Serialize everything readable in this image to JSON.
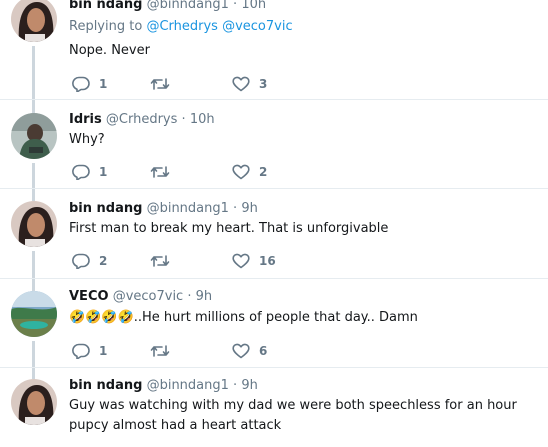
{
  "tweets": [
    {
      "name": "bin ndang",
      "handle": "@binndang1",
      "time": "10h",
      "replying_label": "Replying to",
      "replying_to": [
        "@Crhedrys",
        "@veco7vic"
      ],
      "text": "Nope. Never",
      "replies": "1",
      "retweets": "",
      "likes": "3"
    },
    {
      "name": "Idris",
      "handle": "@Crhedrys",
      "time": "10h",
      "text": "Why?",
      "replies": "1",
      "retweets": "",
      "likes": "2"
    },
    {
      "name": "bin ndang",
      "handle": "@binndang1",
      "time": "9h",
      "text": "First man to break my heart. That is unforgivable",
      "replies": "2",
      "retweets": "",
      "likes": "16"
    },
    {
      "name": "VECO",
      "handle": "@veco7vic",
      "time": "9h",
      "text_emoji": "🤣🤣🤣🤣",
      "text": "..He hurt millions of people that day.. Damn",
      "replies": "1",
      "retweets": "",
      "likes": "6"
    },
    {
      "name": "bin ndang",
      "handle": "@binndang1",
      "time": "9h",
      "text": "Guy was watching with my dad we were both speechless for an hour pupcy almost had a heart attack"
    }
  ],
  "separator": "·",
  "icons": {
    "reply": "reply-icon",
    "retweet": "retweet-icon",
    "like": "heart-icon"
  },
  "colors": {
    "link": "#1b95e0",
    "muted": "#657786",
    "thread_line": "#cdd6dd"
  }
}
